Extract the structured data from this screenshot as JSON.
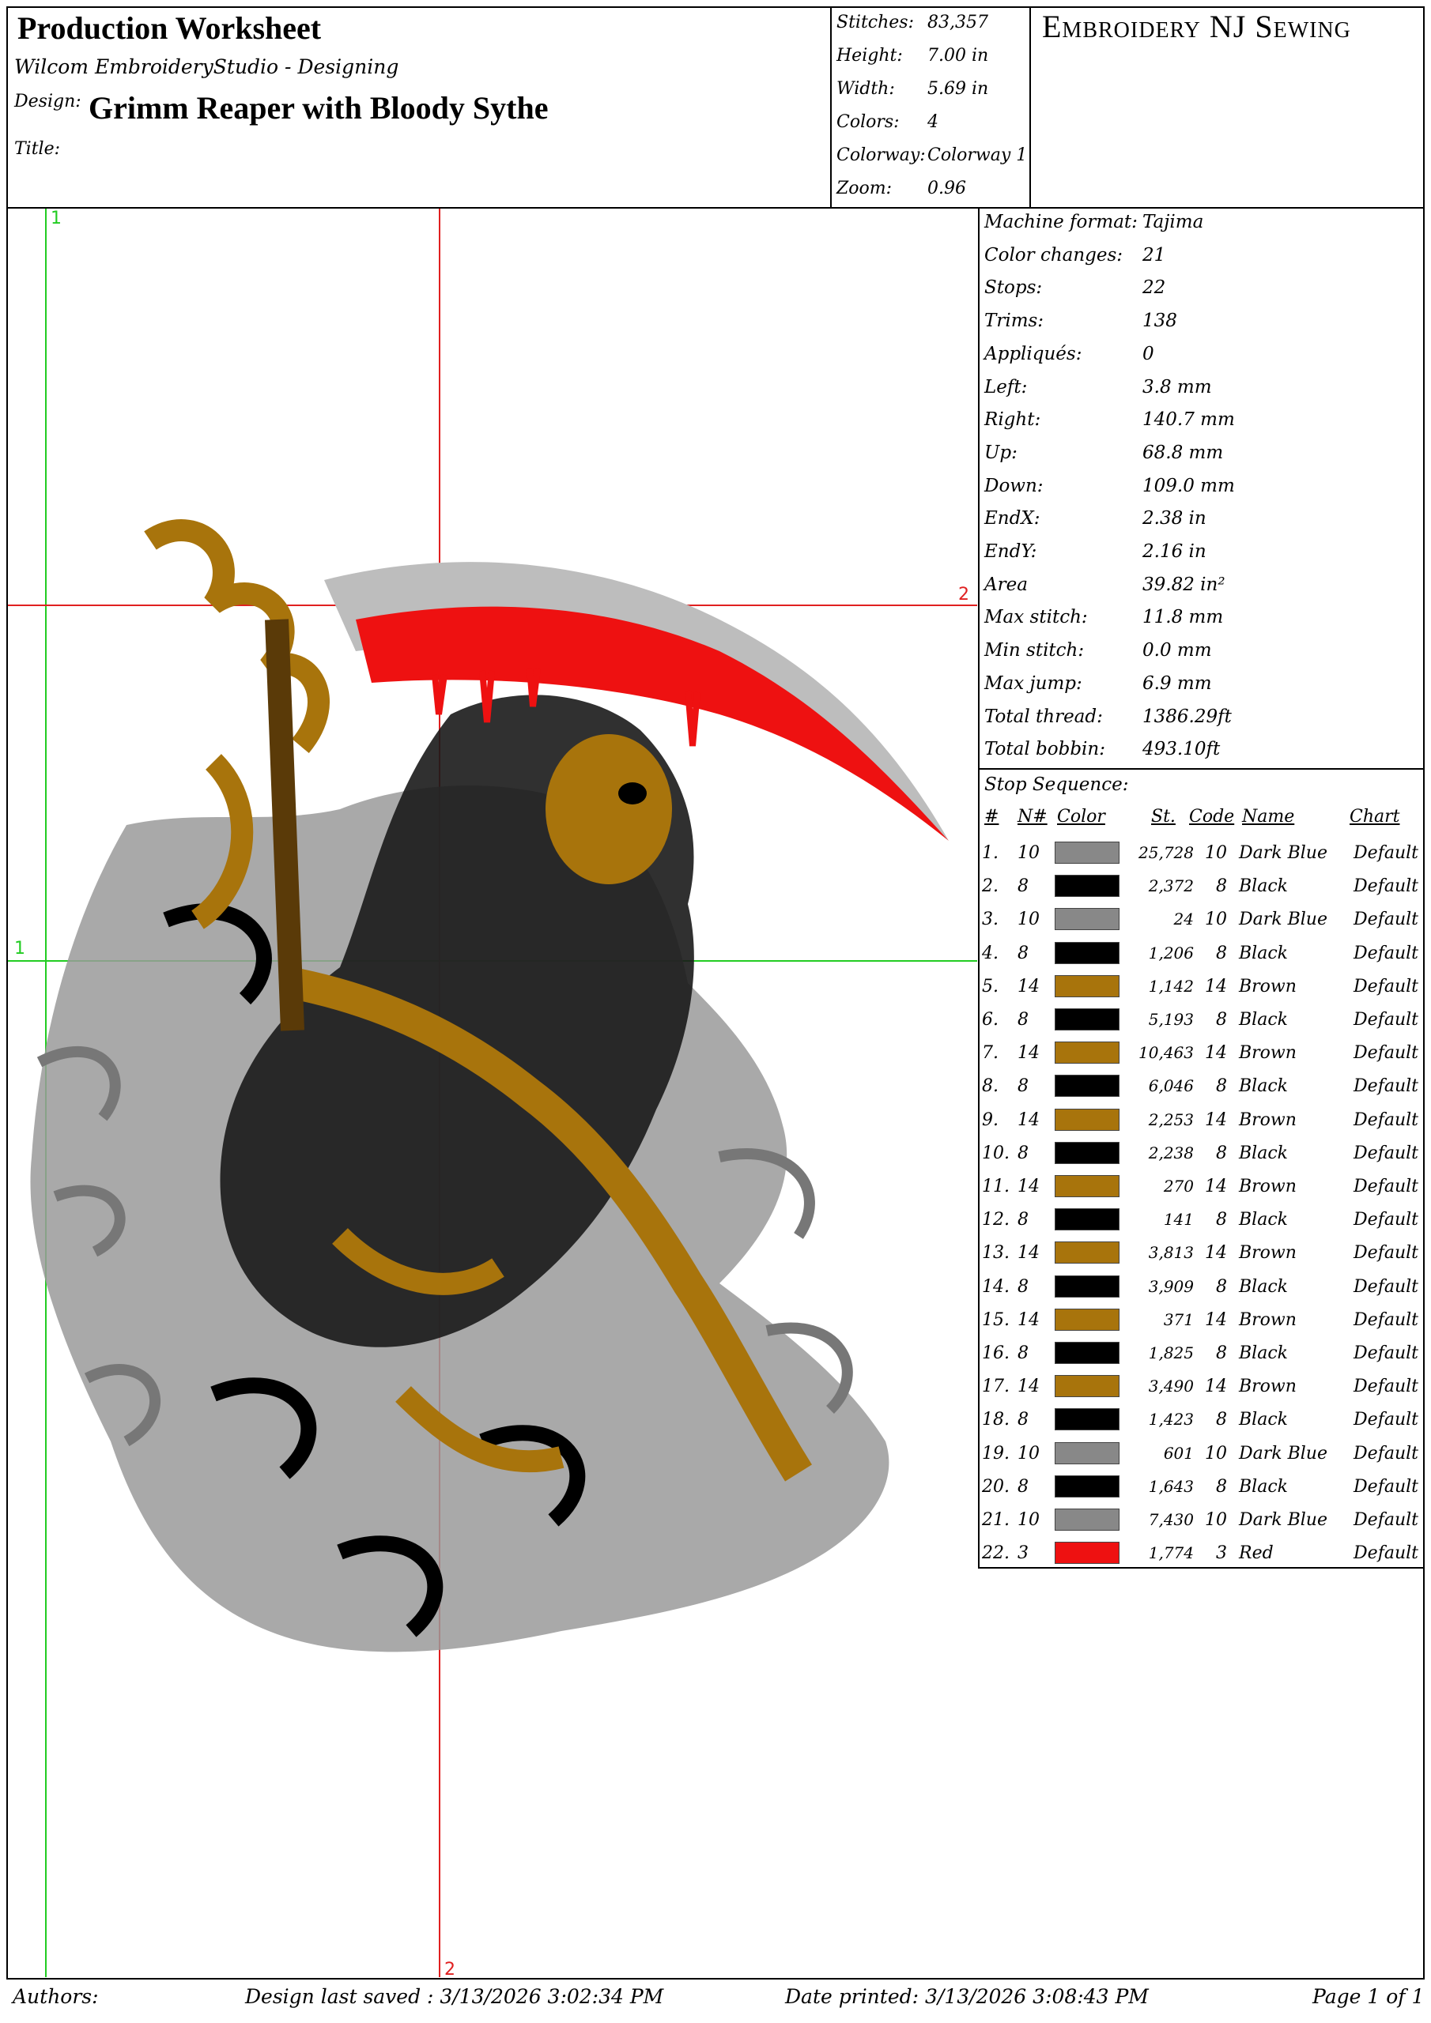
{
  "header": {
    "title": "Production Worksheet",
    "software": "Wilcom EmbroideryStudio - Designing",
    "design_label": "Design:",
    "design_name": "Grimm Reaper with Bloody Sythe",
    "title_label": "Title:",
    "brand": "Embroidery NJ Sewing"
  },
  "summary": [
    {
      "label": "Stitches:",
      "value": "83,357"
    },
    {
      "label": "Height:",
      "value": "7.00  in"
    },
    {
      "label": "Width:",
      "value": "5.69  in"
    },
    {
      "label": "Colors:",
      "value": "4"
    },
    {
      "label": "Colorway:",
      "value": "Colorway 1"
    },
    {
      "label": "Zoom:",
      "value": "0.96"
    }
  ],
  "stats": [
    {
      "label": "Machine format:",
      "value": "Tajima"
    },
    {
      "label": "Color changes:",
      "value": "21"
    },
    {
      "label": "Stops:",
      "value": "22"
    },
    {
      "label": "Trims:",
      "value": "138"
    },
    {
      "label": "Appliqués:",
      "value": "0"
    },
    {
      "label": "Left:",
      "value": "3.8  mm"
    },
    {
      "label": "Right:",
      "value": "140.7  mm"
    },
    {
      "label": "Up:",
      "value": "68.8  mm"
    },
    {
      "label": "Down:",
      "value": "109.0  mm"
    },
    {
      "label": "EndX:",
      "value": "2.38  in"
    },
    {
      "label": "EndY:",
      "value": "2.16  in"
    },
    {
      "label": "Area",
      "value": "39.82  in²"
    },
    {
      "label": "Max stitch:",
      "value": "11.8  mm"
    },
    {
      "label": "Min stitch:",
      "value": "0.0  mm"
    },
    {
      "label": "Max jump:",
      "value": "6.9  mm"
    },
    {
      "label": "Total thread:",
      "value": "1386.29ft"
    },
    {
      "label": "Total bobbin:",
      "value": "493.10ft"
    }
  ],
  "stop_sequence": {
    "label": "Stop Sequence:",
    "headers": {
      "idx": "#",
      "n": "N#",
      "color": "Color",
      "st": "St.",
      "code": "Code",
      "name": "Name",
      "chart": "Chart"
    },
    "rows": [
      {
        "idx": "1.",
        "n": "10",
        "color": "#888888",
        "st": "25,728",
        "code": "10",
        "name": "Dark Blue",
        "chart": "Default"
      },
      {
        "idx": "2.",
        "n": "8",
        "color": "#000000",
        "st": "2,372",
        "code": "8",
        "name": "Black",
        "chart": "Default"
      },
      {
        "idx": "3.",
        "n": "10",
        "color": "#888888",
        "st": "24",
        "code": "10",
        "name": "Dark Blue",
        "chart": "Default"
      },
      {
        "idx": "4.",
        "n": "8",
        "color": "#000000",
        "st": "1,206",
        "code": "8",
        "name": "Black",
        "chart": "Default"
      },
      {
        "idx": "5.",
        "n": "14",
        "color": "#A8740C",
        "st": "1,142",
        "code": "14",
        "name": "Brown",
        "chart": "Default"
      },
      {
        "idx": "6.",
        "n": "8",
        "color": "#000000",
        "st": "5,193",
        "code": "8",
        "name": "Black",
        "chart": "Default"
      },
      {
        "idx": "7.",
        "n": "14",
        "color": "#A8740C",
        "st": "10,463",
        "code": "14",
        "name": "Brown",
        "chart": "Default"
      },
      {
        "idx": "8.",
        "n": "8",
        "color": "#000000",
        "st": "6,046",
        "code": "8",
        "name": "Black",
        "chart": "Default"
      },
      {
        "idx": "9.",
        "n": "14",
        "color": "#A8740C",
        "st": "2,253",
        "code": "14",
        "name": "Brown",
        "chart": "Default"
      },
      {
        "idx": "10.",
        "n": "8",
        "color": "#000000",
        "st": "2,238",
        "code": "8",
        "name": "Black",
        "chart": "Default"
      },
      {
        "idx": "11.",
        "n": "14",
        "color": "#A8740C",
        "st": "270",
        "code": "14",
        "name": "Brown",
        "chart": "Default"
      },
      {
        "idx": "12.",
        "n": "8",
        "color": "#000000",
        "st": "141",
        "code": "8",
        "name": "Black",
        "chart": "Default"
      },
      {
        "idx": "13.",
        "n": "14",
        "color": "#A8740C",
        "st": "3,813",
        "code": "14",
        "name": "Brown",
        "chart": "Default"
      },
      {
        "idx": "14.",
        "n": "8",
        "color": "#000000",
        "st": "3,909",
        "code": "8",
        "name": "Black",
        "chart": "Default"
      },
      {
        "idx": "15.",
        "n": "14",
        "color": "#A8740C",
        "st": "371",
        "code": "14",
        "name": "Brown",
        "chart": "Default"
      },
      {
        "idx": "16.",
        "n": "8",
        "color": "#000000",
        "st": "1,825",
        "code": "8",
        "name": "Black",
        "chart": "Default"
      },
      {
        "idx": "17.",
        "n": "14",
        "color": "#A8740C",
        "st": "3,490",
        "code": "14",
        "name": "Brown",
        "chart": "Default"
      },
      {
        "idx": "18.",
        "n": "8",
        "color": "#000000",
        "st": "1,423",
        "code": "8",
        "name": "Black",
        "chart": "Default"
      },
      {
        "idx": "19.",
        "n": "10",
        "color": "#888888",
        "st": "601",
        "code": "10",
        "name": "Dark Blue",
        "chart": "Default"
      },
      {
        "idx": "20.",
        "n": "8",
        "color": "#000000",
        "st": "1,643",
        "code": "8",
        "name": "Black",
        "chart": "Default"
      },
      {
        "idx": "21.",
        "n": "10",
        "color": "#888888",
        "st": "7,430",
        "code": "10",
        "name": "Dark Blue",
        "chart": "Default"
      },
      {
        "idx": "22.",
        "n": "3",
        "color": "#EE1111",
        "st": "1,774",
        "code": "3",
        "name": "Red",
        "chart": "Default"
      }
    ]
  },
  "guides": {
    "green_top": "1",
    "green_left": "1",
    "red_right": "2",
    "red_bottom": "2"
  },
  "footer": {
    "authors": "Authors:",
    "saved": "Design last saved : 3/13/2026  3:02:34  PM",
    "printed": "Date printed: 3/13/2026  3:08:43  PM",
    "page": "Page 1 of 1"
  },
  "colors": {
    "grey": "#888888",
    "black": "#000000",
    "brown": "#A8740C",
    "red": "#EE1111",
    "guide_green": "#22CC22",
    "guide_red": "#E02020"
  }
}
